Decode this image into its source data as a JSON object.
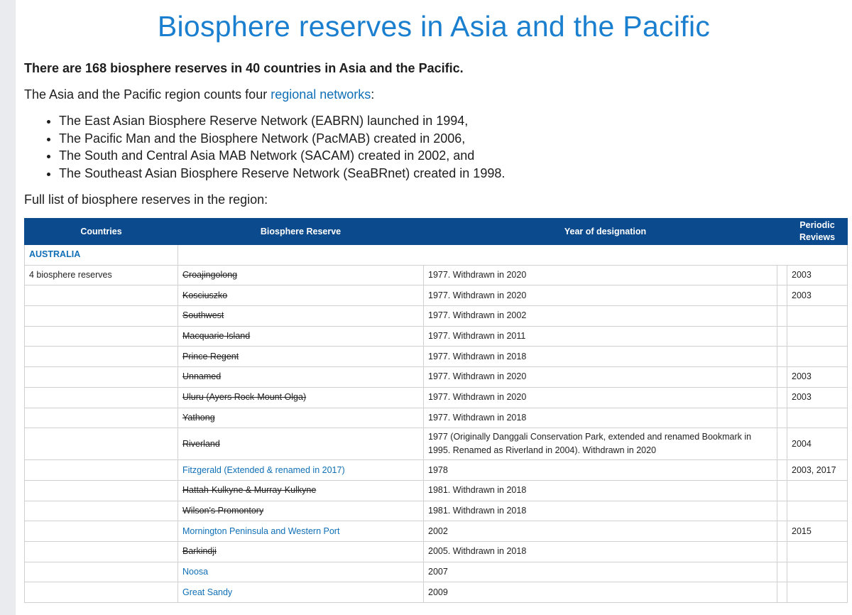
{
  "page": {
    "title": "Biosphere reserves in Asia and the Pacific",
    "summary": "There are 168 biosphere reserves in 40 countries in Asia and the Pacific.",
    "intro_before": "The Asia and the Pacific region counts four ",
    "intro_link": "regional networks",
    "intro_after": ":",
    "networks": [
      "The East Asian Biosphere Reserve Network (EABRN) launched in 1994,",
      "The Pacific Man and the Biosphere Network (PacMAB) created in 2006,",
      "The South and Central Asia MAB Network (SACAM) created in 2002, and",
      "The Southeast Asian Biosphere Reserve Network (SeaBRnet) created in 1998."
    ],
    "full_list_label": "Full list of biosphere reserves in the region:"
  },
  "colors": {
    "accent": "#1a7fcf",
    "link": "#0f6fb6",
    "header_bg": "#0b4a8c"
  },
  "table": {
    "headers": {
      "countries": "Countries",
      "reserve": "Biosphere Reserve",
      "year": "Year of designation",
      "reviews": "Periodic Reviews"
    },
    "country": "AUSTRALIA",
    "country_count": "4 biosphere reserves",
    "rows": [
      {
        "name": "Croajingolong",
        "year": "1977. Withdrawn in 2020",
        "review": "2003",
        "withdrawn": true
      },
      {
        "name": "Kosciuszko",
        "year": "1977. Withdrawn in 2020",
        "review": "2003",
        "withdrawn": true
      },
      {
        "name": "Southwest",
        "year": "1977. Withdrawn in 2002",
        "review": "",
        "withdrawn": true
      },
      {
        "name": "Macquarie Island",
        "year": "1977. Withdrawn in 2011",
        "review": "",
        "withdrawn": true
      },
      {
        "name": "Prince Regent",
        "year": "1977. Withdrawn in 2018",
        "review": "",
        "withdrawn": true
      },
      {
        "name": "Unnamed",
        "year": "1977. Withdrawn in 2020",
        "review": "2003",
        "withdrawn": true
      },
      {
        "name": "Uluru (Ayers Rock-Mount Olga)",
        "year": "1977. Withdrawn in 2020",
        "review": "2003",
        "withdrawn": true
      },
      {
        "name": "Yathong",
        "year": "1977. Withdrawn in 2018",
        "review": "",
        "withdrawn": true
      },
      {
        "name": "Riverland",
        "year": "1977 (Originally Danggali Conservation Park, extended and renamed Bookmark in 1995. Renamed as Riverland in 2004). Withdrawn in 2020",
        "review": "2004",
        "withdrawn": true
      },
      {
        "name": "Fitzgerald (Extended & renamed in 2017)",
        "year": "1978",
        "review": "2003, 2017",
        "withdrawn": false
      },
      {
        "name": "Hattah-Kulkyne & Murray-Kulkyne",
        "year": "1981. Withdrawn in 2018",
        "review": "",
        "withdrawn": true
      },
      {
        "name": "Wilson's Promontory",
        "year": "1981. Withdrawn in 2018",
        "review": "",
        "withdrawn": true
      },
      {
        "name": "Mornington Peninsula and Western Port",
        "year": "2002",
        "review": "2015",
        "withdrawn": false
      },
      {
        "name": "Barkindji",
        "year": "2005. Withdrawn in 2018",
        "review": "",
        "withdrawn": true
      },
      {
        "name": "Noosa",
        "year": "2007",
        "review": "",
        "withdrawn": false
      },
      {
        "name": "Great Sandy",
        "year": "2009",
        "review": "",
        "withdrawn": false
      }
    ]
  }
}
